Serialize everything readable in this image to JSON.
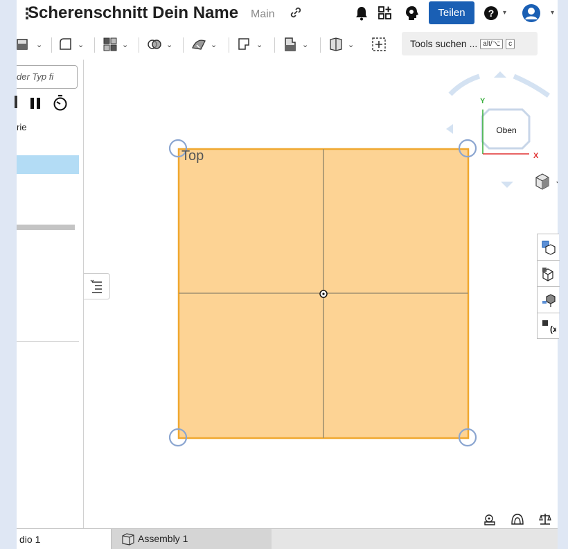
{
  "header": {
    "title": "Scherenschnitt Dein Name",
    "branch": "Main",
    "share_label": "Teilen",
    "link_icon": "link-icon",
    "notification_icon": "bell-icon",
    "apps_icon": "app-store-icon",
    "learning_icon": "learning-center-icon",
    "help_icon": "help-icon",
    "user_icon": "user-avatar-icon"
  },
  "toolbar": {
    "tools": [
      {
        "icon": "plane-icon"
      },
      {
        "icon": "fillet-icon"
      },
      {
        "icon": "pattern-icon"
      },
      {
        "icon": "boolean-icon"
      },
      {
        "icon": "surface-icon"
      },
      {
        "icon": "sheet-metal-icon"
      },
      {
        "icon": "frame-icon"
      },
      {
        "icon": "part-studio-icon"
      }
    ],
    "custom_feature_icon": "custom-feature-icon",
    "search_label": "Tools suchen ...",
    "shortcut_key1": "alt/⌥",
    "shortcut_key2": "c"
  },
  "feature_panel": {
    "filter_placeholder": "der Typ fi",
    "history_label": "rie"
  },
  "viewport": {
    "plane_label": "Top",
    "view_cube": {
      "face": "Oben",
      "axis_x": "X",
      "axis_y": "Y"
    },
    "sketch_fill": "#fdd394",
    "sketch_edge": "#f0a830",
    "handle_color": "#8aa5d0"
  },
  "bottom_tabs": [
    {
      "label": "dio 1",
      "active": true
    },
    {
      "label": "Assembly 1",
      "active": false
    }
  ],
  "colors": {
    "accent": "#1a5fb4",
    "selection": "#b3dcf5"
  }
}
